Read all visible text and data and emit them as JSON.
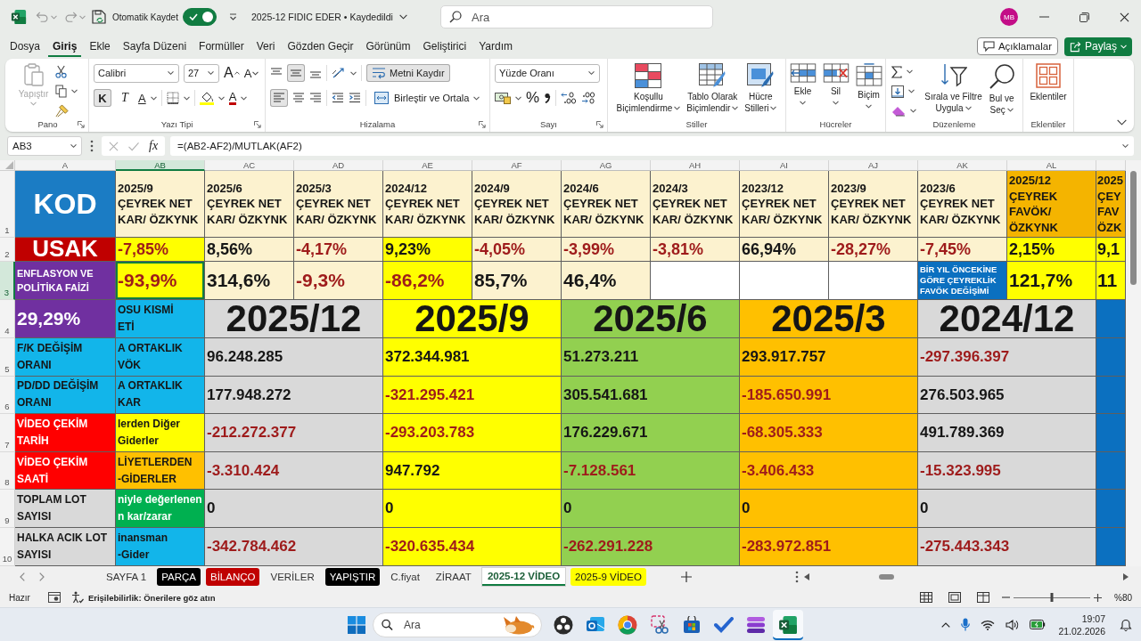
{
  "title_bar": {
    "autosave_label": "Otomatik Kaydet",
    "autosave_on": true,
    "document_title": "2025-12 FIDIC EDER • Kaydedildi",
    "search_placeholder": "Ara",
    "avatar_initials": "MB"
  },
  "menu": {
    "tabs": [
      {
        "label": "Dosya",
        "selected": false
      },
      {
        "label": "Giriş",
        "selected": true
      },
      {
        "label": "Ekle",
        "selected": false
      },
      {
        "label": "Sayfa Düzeni",
        "selected": false
      },
      {
        "label": "Formüller",
        "selected": false
      },
      {
        "label": "Veri",
        "selected": false
      },
      {
        "label": "Gözden Geçir",
        "selected": false
      },
      {
        "label": "Görünüm",
        "selected": false
      },
      {
        "label": "Geliştirici",
        "selected": false
      },
      {
        "label": "Yardım",
        "selected": false
      }
    ],
    "comments_button": "Açıklamalar",
    "share_button": "Paylaş"
  },
  "ribbon": {
    "groups": [
      {
        "kind": "clipboard",
        "label": "Pano",
        "paste_label": "Yapıştır",
        "paste_disabled": true
      },
      {
        "kind": "font",
        "label": "Yazı Tipi",
        "font_name": "Calibri",
        "font_size": "27",
        "grow_key": "A",
        "shrink_key": "A",
        "bold_key": "K",
        "bold": true,
        "italic_key": "T",
        "italic": false,
        "underline_key": "A",
        "font_color_key": "A"
      },
      {
        "kind": "alignment",
        "label": "Hizalama",
        "middle_align": true,
        "left_align": true,
        "wrap_label": "Metni Kaydır",
        "wrap_text": true,
        "merge_label": "Birleştir ve Ortala"
      },
      {
        "kind": "number",
        "label": "Sayı",
        "format": "Yüzde Oranı",
        "percent_key": "%"
      },
      {
        "kind": "styles",
        "label": "Stiller",
        "buttons": [
          {
            "kind": "conditional",
            "label": "Koşullu\nBiçimlendirme"
          },
          {
            "kind": "table",
            "label": "Tablo Olarak\nBiçimlendir"
          },
          {
            "kind": "cell_styles",
            "label": "Hücre\nStilleri"
          }
        ]
      },
      {
        "kind": "cells",
        "label": "Hücreler",
        "buttons": [
          {
            "kind": "insert",
            "label": "Ekle"
          },
          {
            "kind": "delete",
            "label": "Sil"
          },
          {
            "kind": "format",
            "label": "Biçim"
          }
        ]
      },
      {
        "kind": "editing",
        "label": "Düzenleme",
        "buttons": [
          {
            "kind": "sort",
            "label": "Sırala ve Filtre\nUygula"
          },
          {
            "kind": "find",
            "label": "Bul ve\nSeç"
          }
        ]
      },
      {
        "kind": "addins",
        "label": "Eklentiler",
        "buttons": [
          {
            "kind": "addins",
            "label": "Eklentiler"
          }
        ]
      }
    ]
  },
  "formula_bar": {
    "name_box": "AB3",
    "function_key": "fx",
    "formula": "=(AB2-AF2)/MUTLAK(AF2)"
  },
  "sheet": {
    "column_headers": [
      {
        "label": "A",
        "selected": false
      },
      {
        "label": "AB",
        "selected": true
      },
      {
        "label": "AC",
        "selected": false
      },
      {
        "label": "AD",
        "selected": false
      },
      {
        "label": "AE",
        "selected": false
      },
      {
        "label": "AF",
        "selected": false
      },
      {
        "label": "AG",
        "selected": false
      },
      {
        "label": "AH",
        "selected": false
      },
      {
        "label": "AI",
        "selected": false
      },
      {
        "label": "AJ",
        "selected": false
      },
      {
        "label": "AK",
        "selected": false
      },
      {
        "label": "AL",
        "selected": false
      }
    ],
    "rows": [
      {
        "number": "1",
        "selected": false,
        "kind": "header",
        "label": {
          "text": "KOD",
          "color": "#1b7cc4"
        },
        "cells": [
          {
            "text": "2025/9\nÇEYREK NET\nKAR/ ÖZKYNK",
            "color": "#fcf2cf"
          },
          {
            "text": "2025/6\nÇEYREK NET\nKAR/ ÖZKYNK",
            "color": "#fcf2cf"
          },
          {
            "text": "2025/3\nÇEYREK NET\nKAR/ ÖZKYNK",
            "color": "#fcf2cf"
          },
          {
            "text": "2024/12\nÇEYREK NET\nKAR/ ÖZKYNK",
            "color": "#fcf2cf"
          },
          {
            "text": "2024/9\nÇEYREK NET\nKAR/ ÖZKYNK",
            "color": "#fcf2cf"
          },
          {
            "text": "2024/6\nÇEYREK NET\nKAR/ ÖZKYNK",
            "color": "#fcf2cf"
          },
          {
            "text": "2024/3\nÇEYREK NET\nKAR/ ÖZKYNK",
            "color": "#fcf2cf"
          },
          {
            "text": "2023/12\nÇEYREK NET\nKAR/ ÖZKYNK",
            "color": "#fcf2cf"
          },
          {
            "text": "2023/9\nÇEYREK NET\nKAR/ ÖZKYNK",
            "color": "#fcf2cf"
          },
          {
            "text": "2023/6\nÇEYREK NET\nKAR/ ÖZKYNK",
            "color": "#fcf2cf"
          },
          {
            "text": "2025/12\nÇEYREK\nFAVÖK/\nÖZKYNK",
            "color": "#f4b400"
          },
          {
            "text": "2025\nÇEY\nFAV\nÖZK",
            "color": "#f4b400"
          }
        ]
      },
      {
        "number": "2",
        "selected": false,
        "kind": "ratio",
        "label": {
          "text": "USAK",
          "color": "#c00000"
        },
        "cells": [
          {
            "text": "-7,85%",
            "color": "#ffff00",
            "negative": true
          },
          {
            "text": "8,56%",
            "color": "#fcf2cf",
            "negative": false
          },
          {
            "text": "-4,17%",
            "color": "#fcf2cf",
            "negative": true
          },
          {
            "text": "9,23%",
            "color": "#ffff00",
            "negative": false
          },
          {
            "text": "-4,05%",
            "color": "#fcf2cf",
            "negative": true
          },
          {
            "text": "-3,99%",
            "color": "#fcf2cf",
            "negative": true
          },
          {
            "text": "-3,81%",
            "color": "#fcf2cf",
            "negative": true
          },
          {
            "text": "66,94%",
            "color": "#fcf2cf",
            "negative": false
          },
          {
            "text": "-28,27%",
            "color": "#fcf2cf",
            "negative": true
          },
          {
            "text": "-7,45%",
            "color": "#fcf2cf",
            "negative": true
          },
          {
            "text": "2,15%",
            "color": "#ffff00",
            "negative": false
          },
          {
            "text": "9,1",
            "color": "#ffff00",
            "negative": false
          }
        ]
      },
      {
        "number": "3",
        "selected": true,
        "kind": "change",
        "label": {
          "text": "ENFLASYON VE\nPOLİTİKA FAİZİ",
          "color": "#7030a0"
        },
        "cells": [
          {
            "text": "-93,9%",
            "color": "#ffff00",
            "negative": true
          },
          {
            "text": "314,6%",
            "color": "#fcf2cf",
            "negative": false
          },
          {
            "text": "-9,3%",
            "color": "#fcf2cf",
            "negative": true
          },
          {
            "text": "-86,2%",
            "color": "#ffff00",
            "negative": true
          },
          {
            "text": "85,7%",
            "color": "#fcf2cf",
            "negative": false
          },
          {
            "text": "46,4%",
            "color": "#fcf2cf",
            "negative": false
          },
          {
            "color": "#ffffff"
          },
          {
            "color": "#ffffff"
          },
          {
            "color": "#ffffff"
          },
          {
            "note": "BİR YIL ÖNCEKİNE\nGÖRE ÇEYREKLİK\nFAVÖK DEĞİŞİMİ",
            "color": "#0b70c0"
          },
          {
            "text": "121,7%",
            "color": "#ffff00",
            "negative": false
          },
          {
            "text": "11",
            "color": "#ffff00",
            "negative": false
          }
        ]
      },
      {
        "number": "4",
        "selected": false,
        "kind": "period",
        "label": {
          "text": "29,29%",
          "color": "#7030a0"
        },
        "side": {
          "text": "OSU KISMİ\nETİ",
          "color": "#12b5ea"
        },
        "cells": [
          {
            "text": "2025/12",
            "color": "#d9d9d9"
          },
          {
            "text": "2025/9",
            "color": "#ffff00"
          },
          {
            "text": "2025/6",
            "color": "#92d050"
          },
          {
            "text": "2025/3",
            "color": "#ffc000"
          },
          {
            "text": "2024/12",
            "color": "#d9d9d9"
          },
          {
            "color": "#0b70c0"
          }
        ]
      },
      {
        "number": "5",
        "selected": false,
        "kind": "value",
        "label": {
          "text": "F/K DEĞİŞİM\nORANI",
          "color": "#12b5ea"
        },
        "side": {
          "text": "A ORTAKLIK\nVÖK",
          "color": "#12b5ea"
        },
        "cells": [
          {
            "text": "96.248.285",
            "color": "#d9d9d9",
            "negative": false
          },
          {
            "text": "372.344.981",
            "color": "#ffff00",
            "negative": false
          },
          {
            "text": "51.273.211",
            "color": "#92d050",
            "negative": false
          },
          {
            "text": "293.917.757",
            "color": "#ffc000",
            "negative": false
          },
          {
            "text": "-297.396.397",
            "color": "#d9d9d9",
            "negative": true
          },
          {
            "color": "#0b70c0"
          }
        ]
      },
      {
        "number": "6",
        "selected": false,
        "kind": "value",
        "label": {
          "text": "PD/DD DEĞİŞİM\nORANI",
          "color": "#12b5ea"
        },
        "side": {
          "text": "A ORTAKLIK\nKAR",
          "color": "#12b5ea"
        },
        "cells": [
          {
            "text": "177.948.272",
            "color": "#d9d9d9",
            "negative": false
          },
          {
            "text": "-321.295.421",
            "color": "#ffff00",
            "negative": true
          },
          {
            "text": "305.541.681",
            "color": "#92d050",
            "negative": false
          },
          {
            "text": "-185.650.991",
            "color": "#ffc000",
            "negative": true
          },
          {
            "text": "276.503.965",
            "color": "#d9d9d9",
            "negative": false
          },
          {
            "color": "#0b70c0"
          }
        ]
      },
      {
        "number": "7",
        "selected": false,
        "kind": "value",
        "label": {
          "text": "VİDEO ÇEKİM\nTARİH",
          "color": "#ff0000"
        },
        "side": {
          "text": "lerden Diğer\nGiderler",
          "color": "#ffff00"
        },
        "cells": [
          {
            "text": "-212.272.377",
            "color": "#d9d9d9",
            "negative": true
          },
          {
            "text": "-293.203.783",
            "color": "#ffff00",
            "negative": true
          },
          {
            "text": "176.229.671",
            "color": "#92d050",
            "negative": false
          },
          {
            "text": "-68.305.333",
            "color": "#ffc000",
            "negative": true
          },
          {
            "text": "491.789.369",
            "color": "#d9d9d9",
            "negative": false
          },
          {
            "color": "#0b70c0"
          }
        ]
      },
      {
        "number": "8",
        "selected": false,
        "kind": "value",
        "label": {
          "text": "VİDEO ÇEKİM\nSAATİ",
          "color": "#ff0000"
        },
        "side": {
          "text": "LİYETLERDEN\n-GİDERLER",
          "color": "#ffc000"
        },
        "cells": [
          {
            "text": "-3.310.424",
            "color": "#d9d9d9",
            "negative": true
          },
          {
            "text": "947.792",
            "color": "#ffff00",
            "negative": false
          },
          {
            "text": "-7.128.561",
            "color": "#92d050",
            "negative": true
          },
          {
            "text": "-3.406.433",
            "color": "#ffc000",
            "negative": true
          },
          {
            "text": "-15.323.995",
            "color": "#d9d9d9",
            "negative": true
          },
          {
            "color": "#0b70c0"
          }
        ]
      },
      {
        "number": "9",
        "selected": false,
        "kind": "value",
        "label": {
          "text": "TOPLAM LOT\nSAYISI",
          "color": "#d9d9d9"
        },
        "side": {
          "text": "niyle değerlenen\nn kar/zarar",
          "color": "#00b050"
        },
        "cells": [
          {
            "text": "0",
            "color": "#d9d9d9",
            "negative": false
          },
          {
            "text": "0",
            "color": "#ffff00",
            "negative": false
          },
          {
            "text": "0",
            "color": "#92d050",
            "negative": false
          },
          {
            "text": "0",
            "color": "#ffc000",
            "negative": false
          },
          {
            "text": "0",
            "color": "#d9d9d9",
            "negative": false
          },
          {
            "color": "#0b70c0"
          }
        ]
      },
      {
        "number": "10",
        "selected": false,
        "kind": "value",
        "label": {
          "text": "HALKA ACIK LOT\nSAYISI",
          "color": "#d9d9d9"
        },
        "side": {
          "text": "inansman\n-Gider",
          "color": "#12b5ea"
        },
        "cells": [
          {
            "text": "-342.784.462",
            "color": "#d9d9d9",
            "negative": true
          },
          {
            "text": "-320.635.434",
            "color": "#ffff00",
            "negative": true
          },
          {
            "text": "-262.291.228",
            "color": "#92d050",
            "negative": true
          },
          {
            "text": "-283.972.851",
            "color": "#ffc000",
            "negative": true
          },
          {
            "text": "-275.443.343",
            "color": "#d9d9d9",
            "negative": true
          },
          {
            "color": "#0b70c0"
          }
        ]
      }
    ]
  },
  "sheet_bar": {
    "tabs": [
      {
        "label": "SAYFA 1",
        "selected": false
      },
      {
        "label": "PARÇA",
        "selected": false,
        "color": "#000000"
      },
      {
        "label": "BİLANÇO",
        "selected": false,
        "color": "#c00000"
      },
      {
        "label": "VERİLER",
        "selected": false
      },
      {
        "label": "YAPIŞTIR",
        "selected": false,
        "color": "#000000"
      },
      {
        "label": "C.fiyat",
        "selected": false
      },
      {
        "label": "ZİRAAT",
        "selected": false
      },
      {
        "label": "2025-12 VİDEO",
        "selected": true
      },
      {
        "label": "2025-9 VİDEO",
        "selected": false,
        "color": "#ffff00"
      }
    ]
  },
  "status_bar": {
    "status": "Hazır",
    "accessibility": "Erişilebilirlik: Önerilere göz atın",
    "zoom_slider": {
      "level": 0.5
    },
    "zoom": "%80"
  },
  "taskbar": {
    "search_placeholder": "Ara",
    "apps": [
      {
        "kind": "aperture",
        "active": false
      },
      {
        "kind": "mail",
        "active": false
      },
      {
        "kind": "browser",
        "active": false
      },
      {
        "kind": "scissors",
        "active": false
      },
      {
        "kind": "store",
        "active": false
      },
      {
        "kind": "todo",
        "active": false
      },
      {
        "kind": "clip",
        "active": false
      },
      {
        "kind": "excel",
        "active": true
      }
    ],
    "time": "19:07",
    "date": "21.02.2026"
  }
}
